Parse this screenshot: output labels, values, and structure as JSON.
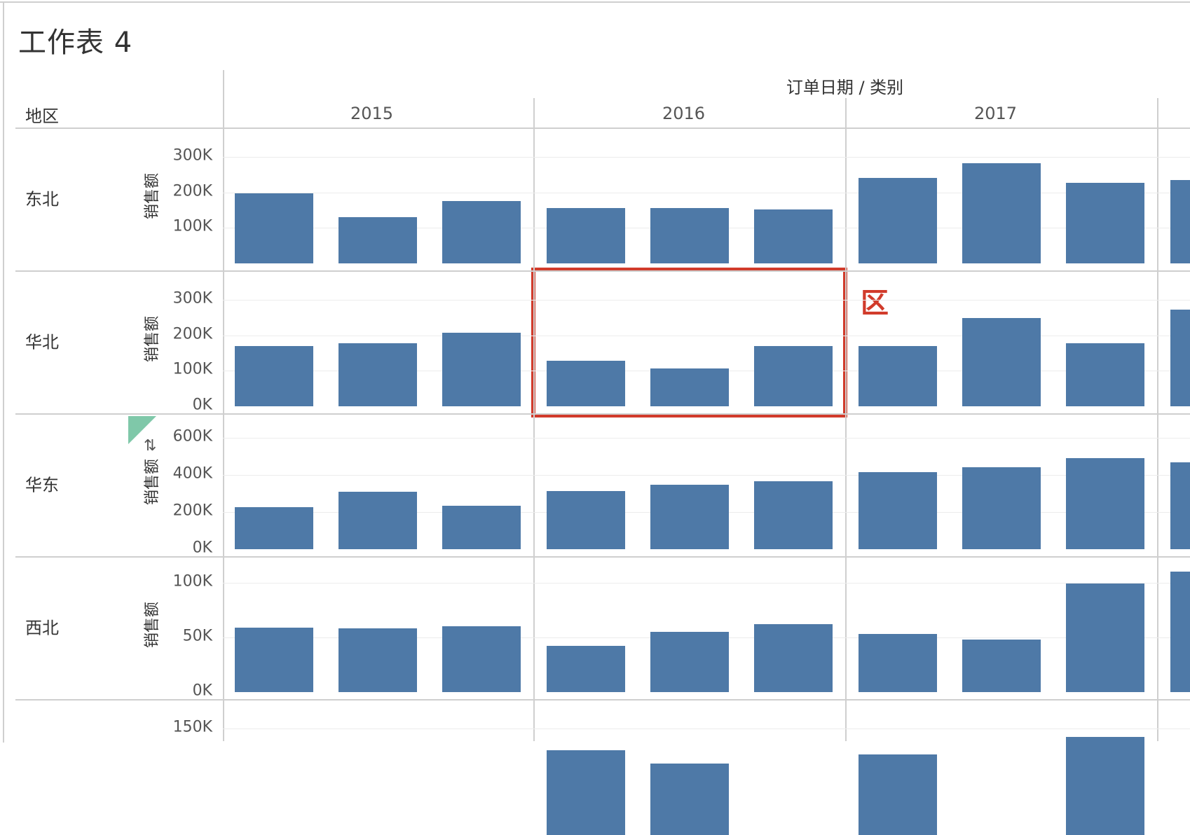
{
  "sheet": {
    "title": "工作表 4",
    "column_header": "订单日期 / 类别",
    "row_header": "地区",
    "years": [
      "2015",
      "2016",
      "2017"
    ],
    "measure_label": "销售额",
    "annotation_text": "区",
    "colors": {
      "bar": "#4e79a7",
      "highlight": "#d13b2b",
      "grid": "#ececec",
      "divider": "#cfcfcf",
      "marker": "#7fc8a9"
    },
    "icons": {
      "sort": "sort-icon",
      "corner": "pane-corner-marker"
    }
  },
  "chart_data": {
    "type": "bar",
    "title": "工作表 4",
    "xlabel": "订单日期 / 类别",
    "ylabel": "销售额",
    "column_groups": [
      "2015",
      "2016",
      "2017"
    ],
    "rows": [
      {
        "region": "东北",
        "ylim": [
          0,
          340000
        ],
        "ticks": [
          {
            "v": 100000,
            "label": "100K"
          },
          {
            "v": 200000,
            "label": "200K"
          },
          {
            "v": 300000,
            "label": "300K"
          }
        ],
        "values": [
          [
            197000,
            131000,
            175000
          ],
          [
            156000,
            156000,
            152000
          ],
          [
            241000,
            282000,
            227000
          ],
          [
            236000
          ]
        ]
      },
      {
        "region": "华北",
        "ylim": [
          0,
          340000
        ],
        "ticks": [
          {
            "v": 0,
            "label": "0K"
          },
          {
            "v": 100000,
            "label": "100K"
          },
          {
            "v": 200000,
            "label": "200K"
          },
          {
            "v": 300000,
            "label": "300K"
          }
        ],
        "values": [
          [
            170000,
            178000,
            208000
          ],
          [
            128000,
            107000,
            170000
          ],
          [
            170000,
            250000,
            178000
          ],
          [
            272000
          ]
        ]
      },
      {
        "region": "华东",
        "ylim": [
          0,
          650000
        ],
        "ticks": [
          {
            "v": 0,
            "label": "0K"
          },
          {
            "v": 200000,
            "label": "200K"
          },
          {
            "v": 400000,
            "label": "400K"
          },
          {
            "v": 600000,
            "label": "600K"
          }
        ],
        "values": [
          [
            228000,
            308000,
            236000
          ],
          [
            312000,
            346000,
            365000
          ],
          [
            417000,
            442000,
            493000
          ],
          [
            468000
          ]
        ]
      },
      {
        "region": "西北",
        "ylim": [
          0,
          110000
        ],
        "ticks": [
          {
            "v": 0,
            "label": "0K"
          },
          {
            "v": 50000,
            "label": "50K"
          },
          {
            "v": 100000,
            "label": "100K"
          }
        ],
        "values": [
          [
            59000,
            58000,
            60000
          ],
          [
            42000,
            55000,
            62000
          ],
          [
            53000,
            48000,
            99000
          ],
          [
            110000
          ]
        ]
      },
      {
        "region": "",
        "ylim": [
          0,
          170000
        ],
        "ticks": [
          {
            "v": 150000,
            "label": "150K"
          }
        ],
        "values": [
          [
            0,
            0,
            0
          ],
          [
            120000,
            101000,
            0
          ],
          [
            114000,
            0,
            138000
          ],
          [
            0
          ]
        ]
      }
    ]
  }
}
